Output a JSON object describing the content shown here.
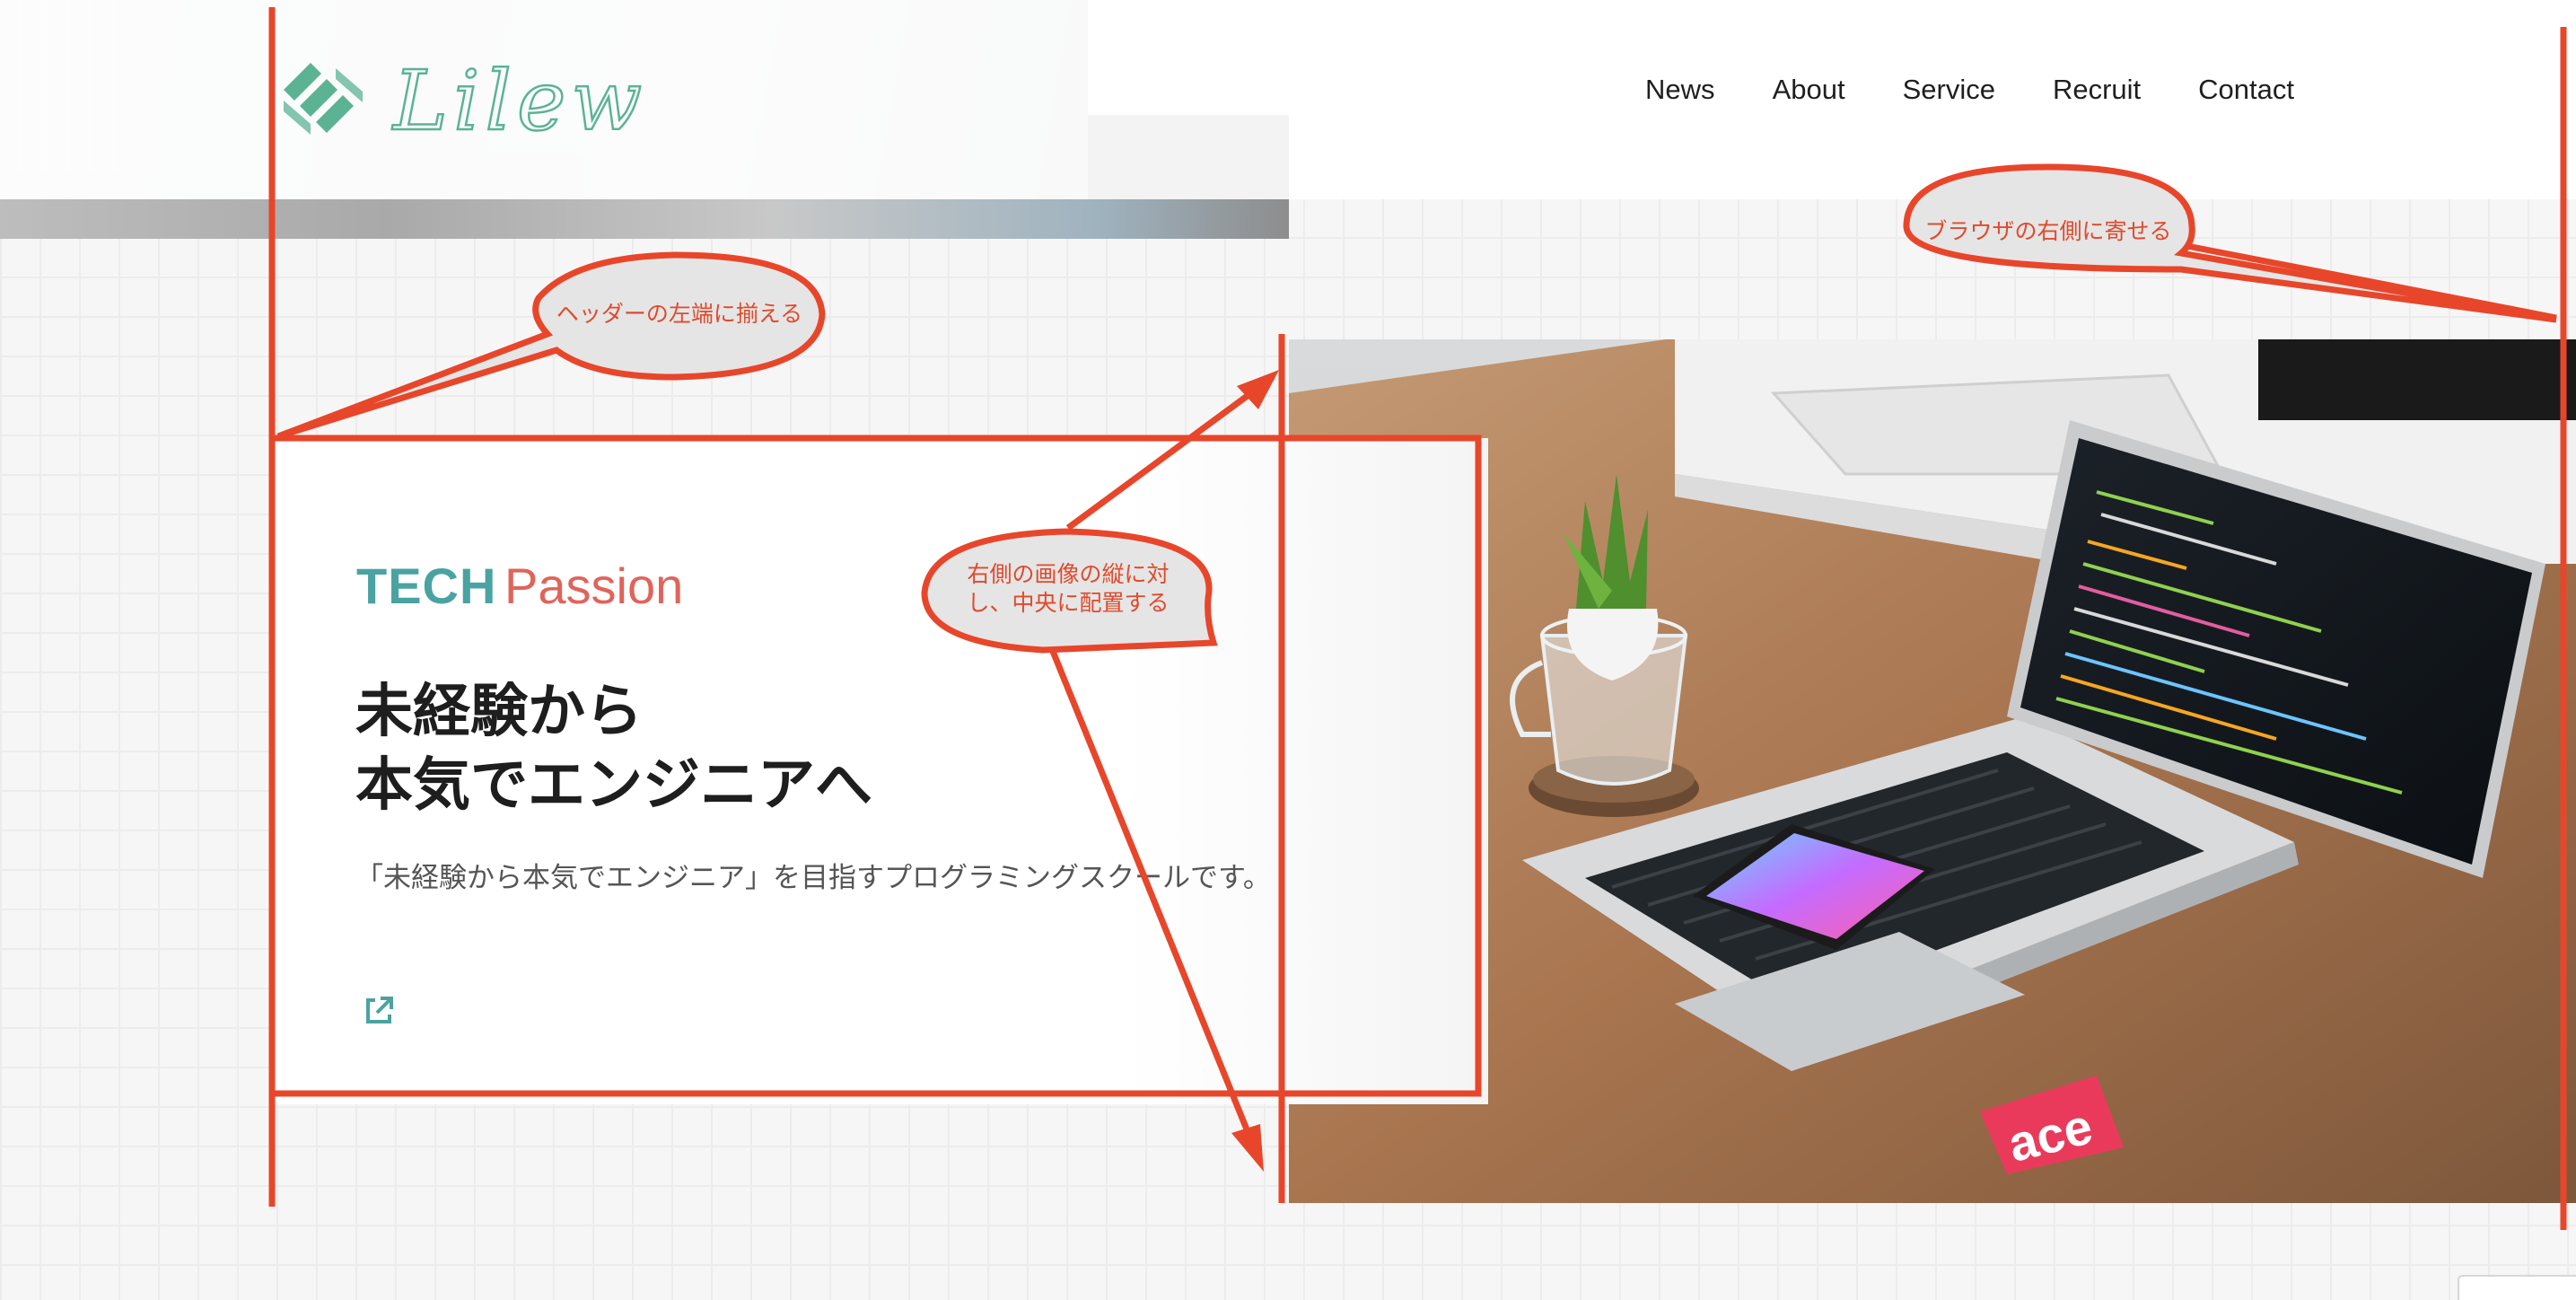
{
  "header": {
    "logo_text": "Lilew",
    "nav": [
      "News",
      "About",
      "Service",
      "Recruit",
      "Contact"
    ]
  },
  "card": {
    "logo_tech": "TECH",
    "logo_passion": "Passion",
    "title_line1": "未経験から",
    "title_line2": "本気でエンジニアへ",
    "description": "「未経験から本気でエンジニア」を目指すプログラミングスクールです。",
    "link_icon": "external-link-icon"
  },
  "annotations": {
    "header_left": "ヘッダーの左端に揃える",
    "browser_right": "ブラウザの右側に寄せる",
    "center_line1": "右側の画像の縦に対",
    "center_line2": "し、中央に配置する"
  },
  "colors": {
    "annotation": "#e8462a",
    "brand_teal": "#4aa3a2",
    "brand_coral": "#e0645a",
    "logo_green": "#5bb394"
  }
}
